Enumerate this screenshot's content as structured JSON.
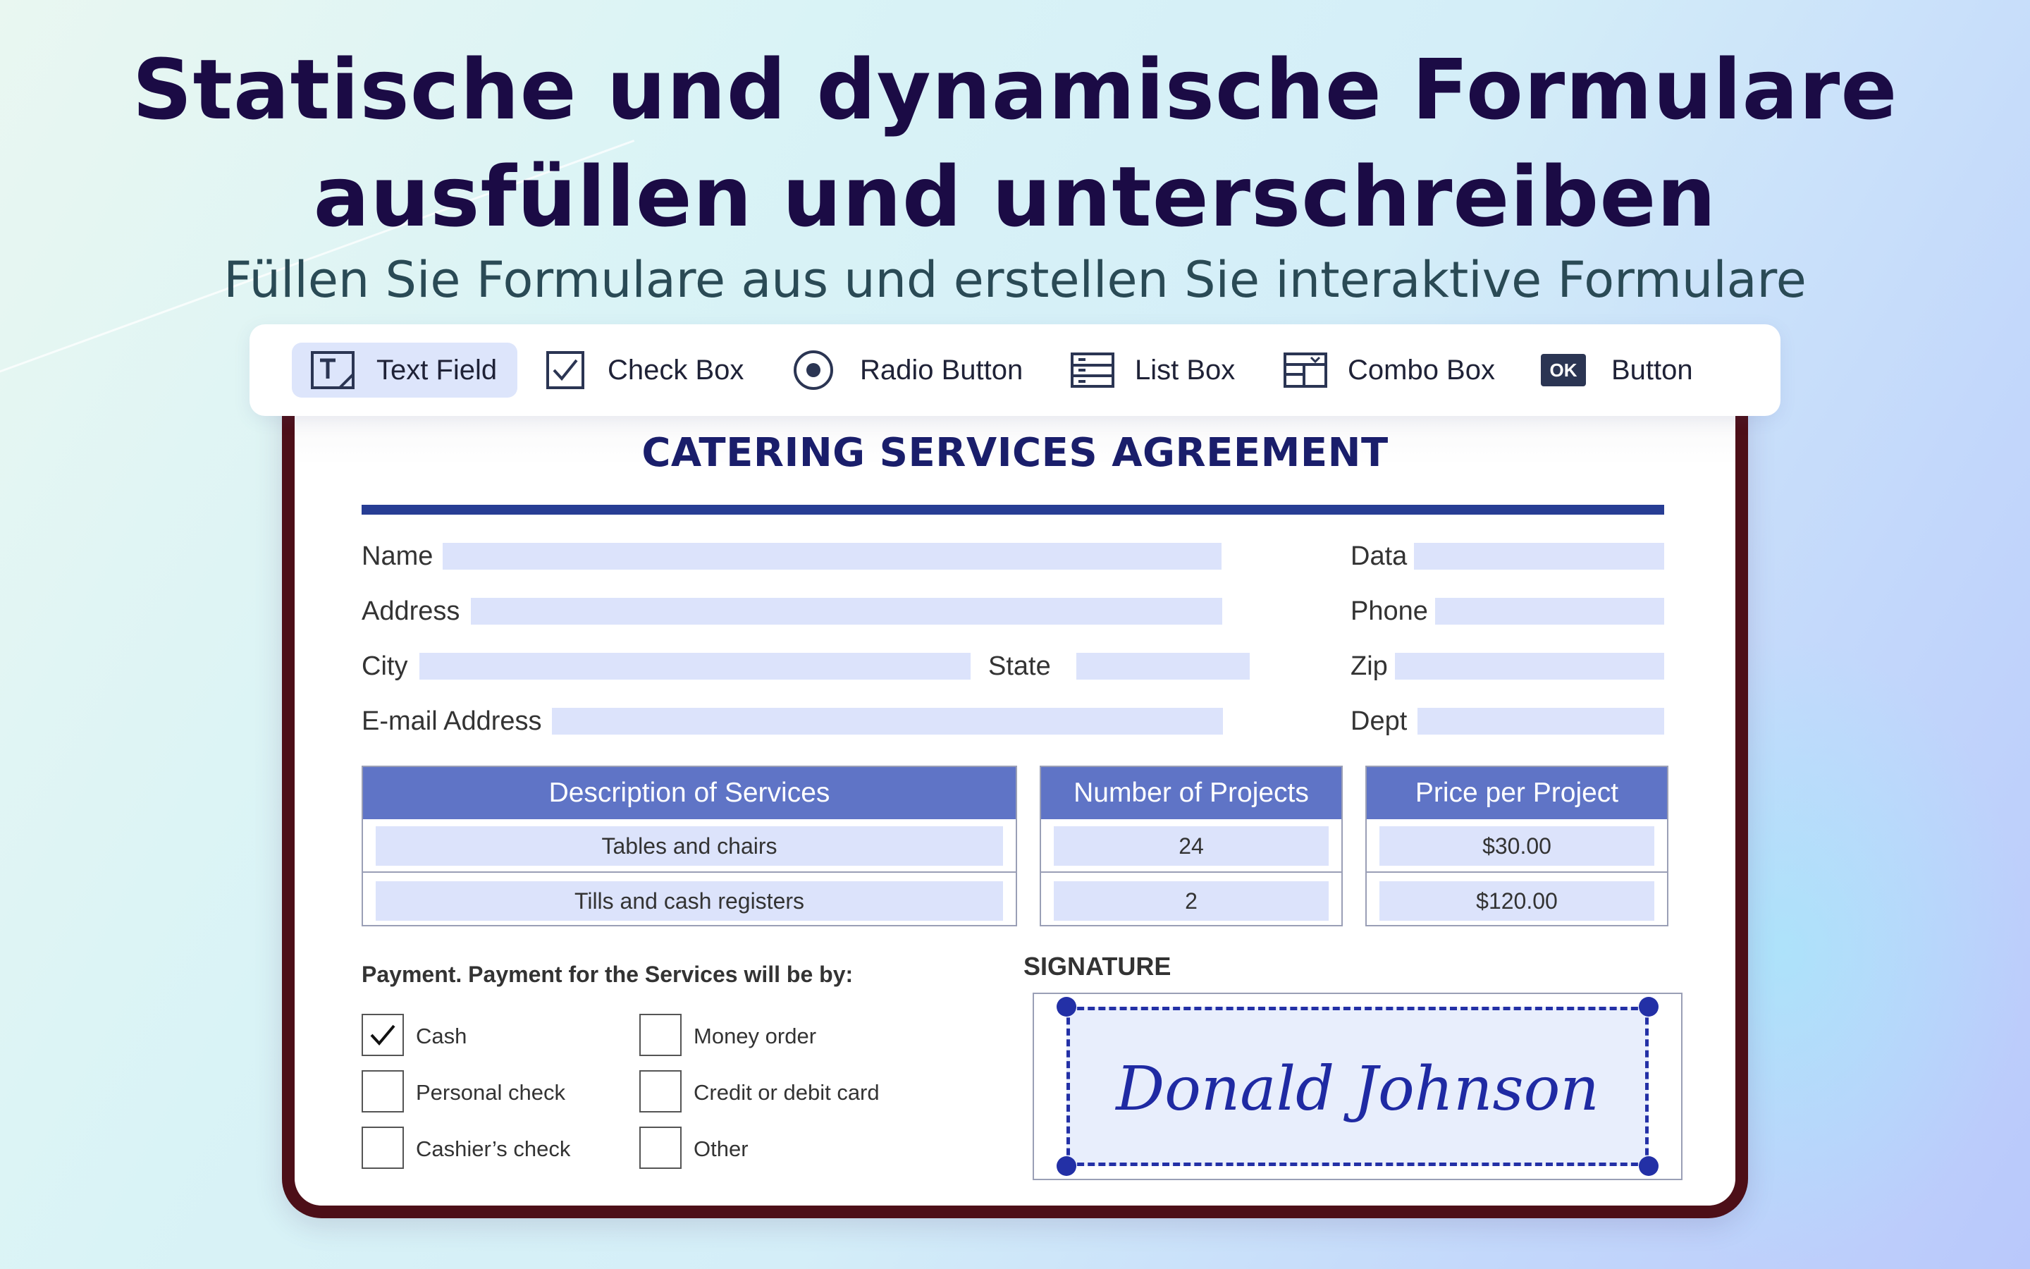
{
  "headline": {
    "line1": "Statische und dynamische Formulare",
    "line2": "ausfüllen und unterschreiben",
    "subtitle": "Füllen Sie Formulare aus und erstellen Sie interaktive Formulare"
  },
  "toolbar": {
    "items": [
      {
        "label": "Text Field",
        "icon": "text-field-icon",
        "active": true
      },
      {
        "label": "Check Box",
        "icon": "checkbox-icon"
      },
      {
        "label": "Radio Button",
        "icon": "radio-button-icon"
      },
      {
        "label": "List Box",
        "icon": "list-box-icon"
      },
      {
        "label": "Combo Box",
        "icon": "combo-box-icon"
      },
      {
        "label": "Button",
        "icon": "ok-button-icon",
        "icon_text": "OK"
      }
    ]
  },
  "form": {
    "title": "CATERING SERVICES AGREEMENT",
    "labels": {
      "name": "Name",
      "data": "Data",
      "address": "Address",
      "phone": "Phone",
      "city": "City",
      "state": "State",
      "zip": "Zip",
      "email": "E-mail Address",
      "dept": "Dept"
    },
    "table": {
      "headers": [
        "Description of Services",
        "Number of Projects",
        "Price per Project"
      ],
      "rows": [
        [
          "Tables and chairs",
          "24",
          "$30.00"
        ],
        [
          "Tills and cash registers",
          "2",
          "$120.00"
        ]
      ]
    },
    "payment": {
      "title": "Payment. Payment for the Services will be by:",
      "options": [
        {
          "label": "Cash",
          "checked": true
        },
        {
          "label": "Money order",
          "checked": false
        },
        {
          "label": "Personal check",
          "checked": false
        },
        {
          "label": "Credit or debit card",
          "checked": false
        },
        {
          "label": "Cashier’s check",
          "checked": false
        },
        {
          "label": "Other",
          "checked": false
        }
      ]
    },
    "signature": {
      "title": "SIGNATURE",
      "name": "Donald Johnson"
    }
  },
  "colors": {
    "headline": "#1b0b45",
    "form_title": "#1a1e6b",
    "accent_rule": "#273d94",
    "table_header": "#5f74c6",
    "field_fill": "#dce3fb",
    "signature_ink": "#1f2aa3",
    "frame": "#4d0f18"
  }
}
